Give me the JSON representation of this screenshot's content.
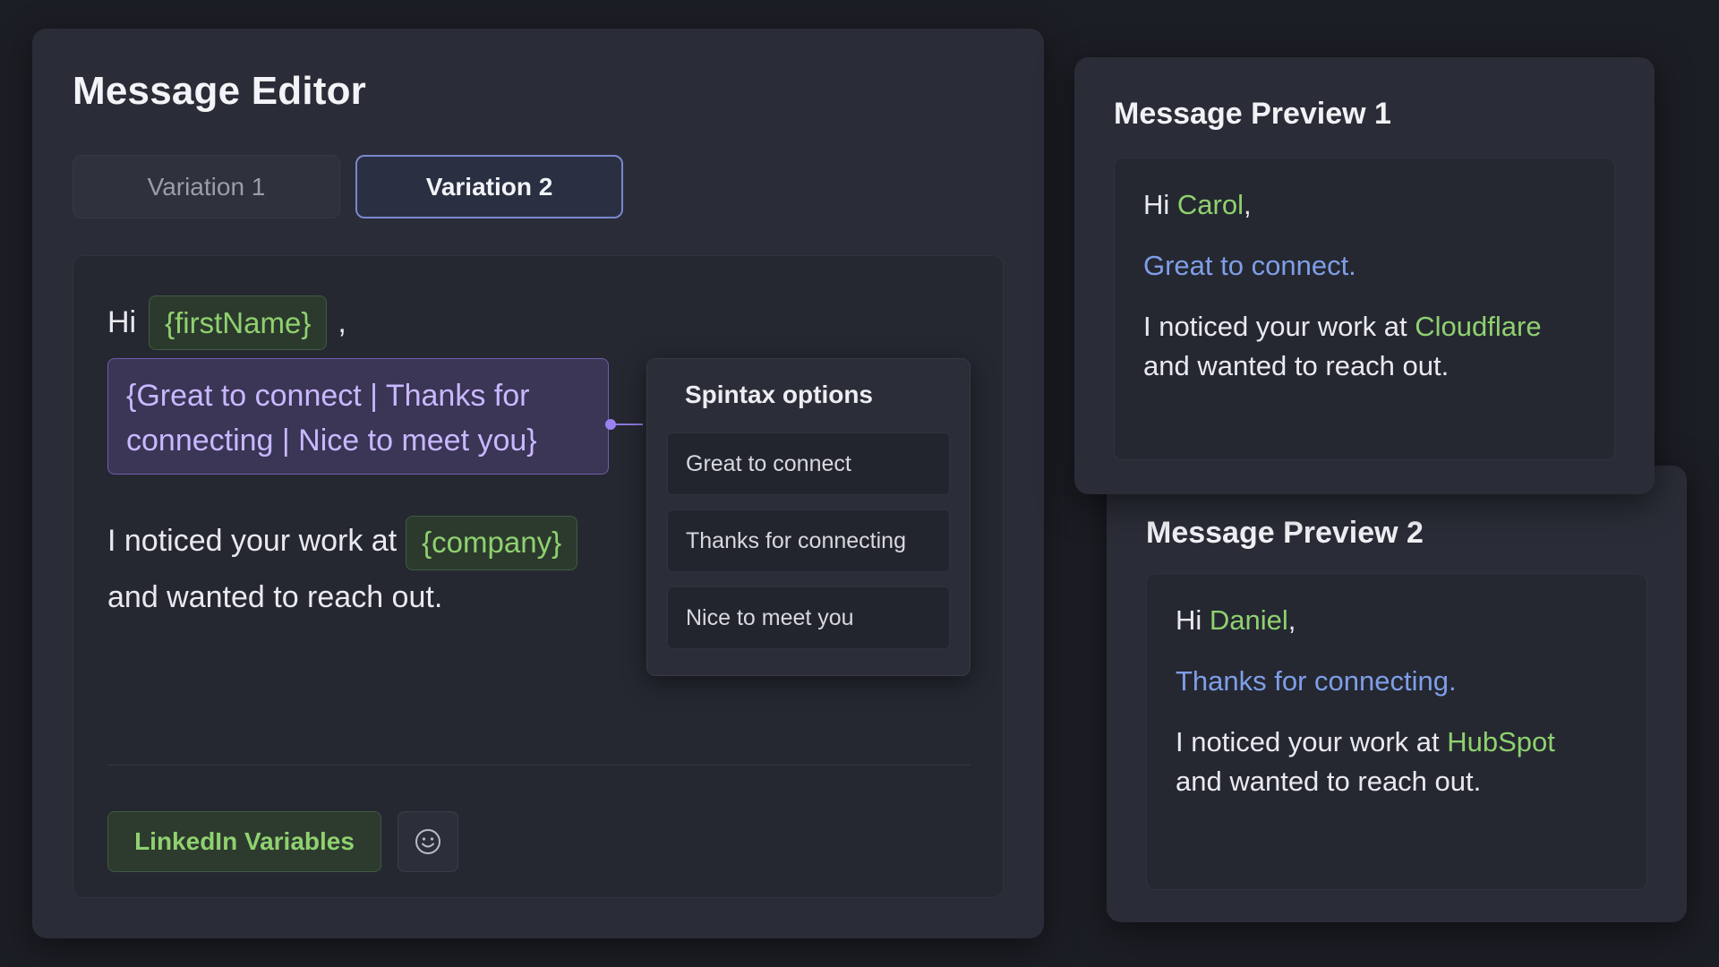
{
  "editor": {
    "title": "Message Editor",
    "tabs": [
      {
        "label": "Variation 1",
        "active": false
      },
      {
        "label": "Variation 2",
        "active": true
      }
    ],
    "greeting": "Hi",
    "first_name_variable": "{firstName}",
    "comma": ",",
    "spintax_text": "{Great to connect | Thanks for connecting | Nice to meet you}",
    "body_prefix": "I noticed your work at",
    "company_variable": "{company}",
    "body_suffix": "and wanted to reach out.",
    "spintax_panel": {
      "title": "Spintax options",
      "options": [
        "Great to connect",
        "Thanks for connecting",
        "Nice to meet you"
      ]
    },
    "linkedin_button": "LinkedIn Variables",
    "emoji_icon": "smiley-icon"
  },
  "previews": [
    {
      "title": "Message Preview 1",
      "greeting": "Hi",
      "name": "Carol",
      "comma": ",",
      "spintax_choice": "Great to connect.",
      "body_prefix": "I noticed your work at",
      "company": "Cloudflare",
      "body_suffix": "and wanted to reach out."
    },
    {
      "title": "Message Preview 2",
      "greeting": "Hi",
      "name": "Daniel",
      "comma": ",",
      "spintax_choice": "Thanks for connecting.",
      "body_prefix": "I noticed your work at",
      "company": "HubSpot",
      "body_suffix": "and wanted to reach out."
    }
  ],
  "colors": {
    "background": "#1c1e25",
    "card": "#2a2d37",
    "variable_green": "#8fd16f",
    "spintax_purple": "#c9b8ff",
    "spintax_blue": "#7f9ee8",
    "active_tab_border": "#7b87cf"
  }
}
